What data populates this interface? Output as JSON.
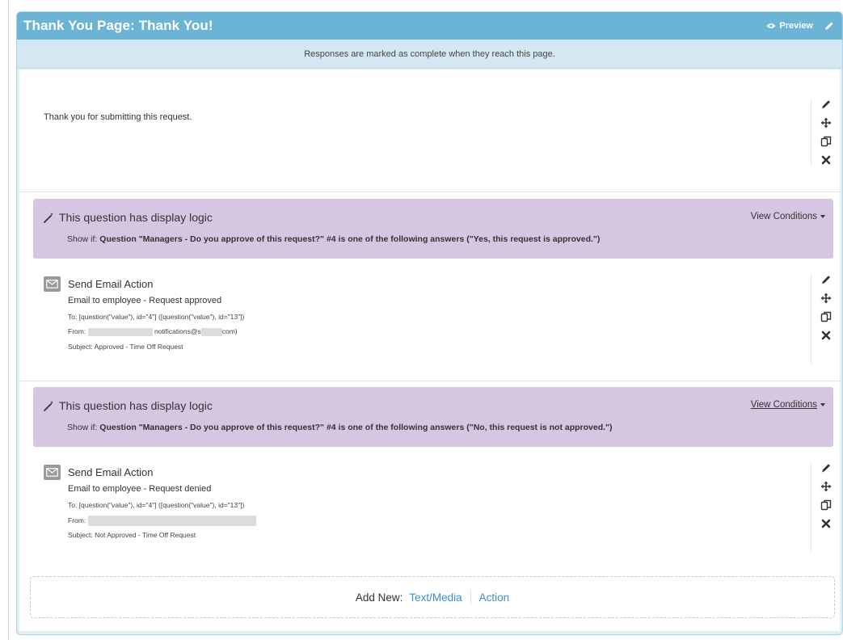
{
  "page": {
    "title": "Thank You Page: Thank You!",
    "preview_label": "Preview",
    "notice": "Responses are marked as complete when they reach this page."
  },
  "text_block": {
    "body": "Thank you for submitting this request."
  },
  "logic_blocks": [
    {
      "title": "This question has display logic",
      "view_conditions_label": "View Conditions",
      "show_if_prefix": "Show if:",
      "condition": "Question \"Managers - Do you approve of this request?\" #4 is one of the following answers (\"Yes, this request is approved.\")"
    },
    {
      "title": "This question has display logic",
      "view_conditions_label": "View Conditions",
      "show_if_prefix": "Show if:",
      "condition": "Question \"Managers - Do you approve of this request?\" #4 is one of the following answers (\"No, this request is not approved.\")"
    }
  ],
  "email_actions": [
    {
      "title": "Send Email Action",
      "name": "Email to employee - Request approved",
      "to": "To: [question(\"value\"), id=\"4\"] ([question(\"value\"), id=\"13\"])",
      "from_label": "From:",
      "from_mid": "notifications@s",
      "from_end": "com)",
      "subject": "Subject: Approved - Time Off Request"
    },
    {
      "title": "Send Email Action",
      "name": "Email to employee - Request denied",
      "to": "To: [question(\"value\"), id=\"4\"] ([question(\"value\"), id=\"13\"])",
      "from_label": "From:",
      "subject": "Subject: Not Approved - Time Off Request"
    }
  ],
  "add_new": {
    "label": "Add New:",
    "text_media": "Text/Media",
    "action": "Action"
  },
  "colors": {
    "header": "#6cb4d6",
    "logic_banner": "#d7c6e1",
    "link": "#3a8fc4"
  },
  "icons": [
    "eye-icon",
    "pencil-icon",
    "move-icon",
    "copy-icon",
    "delete-icon",
    "wand-icon",
    "mail-icon",
    "caret-down-icon"
  ]
}
